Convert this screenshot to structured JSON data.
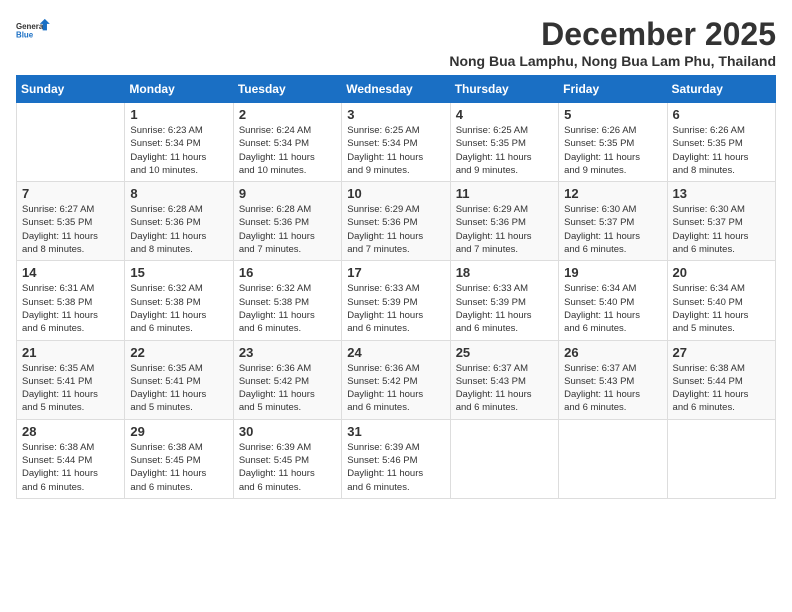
{
  "logo": {
    "line1": "General",
    "line2": "Blue"
  },
  "title": {
    "month": "December 2025",
    "location": "Nong Bua Lamphu, Nong Bua Lam Phu, Thailand"
  },
  "headers": [
    "Sunday",
    "Monday",
    "Tuesday",
    "Wednesday",
    "Thursday",
    "Friday",
    "Saturday"
  ],
  "weeks": [
    [
      {
        "day": "",
        "info": ""
      },
      {
        "day": "1",
        "info": "Sunrise: 6:23 AM\nSunset: 5:34 PM\nDaylight: 11 hours\nand 10 minutes."
      },
      {
        "day": "2",
        "info": "Sunrise: 6:24 AM\nSunset: 5:34 PM\nDaylight: 11 hours\nand 10 minutes."
      },
      {
        "day": "3",
        "info": "Sunrise: 6:25 AM\nSunset: 5:34 PM\nDaylight: 11 hours\nand 9 minutes."
      },
      {
        "day": "4",
        "info": "Sunrise: 6:25 AM\nSunset: 5:35 PM\nDaylight: 11 hours\nand 9 minutes."
      },
      {
        "day": "5",
        "info": "Sunrise: 6:26 AM\nSunset: 5:35 PM\nDaylight: 11 hours\nand 9 minutes."
      },
      {
        "day": "6",
        "info": "Sunrise: 6:26 AM\nSunset: 5:35 PM\nDaylight: 11 hours\nand 8 minutes."
      }
    ],
    [
      {
        "day": "7",
        "info": "Sunrise: 6:27 AM\nSunset: 5:35 PM\nDaylight: 11 hours\nand 8 minutes."
      },
      {
        "day": "8",
        "info": "Sunrise: 6:28 AM\nSunset: 5:36 PM\nDaylight: 11 hours\nand 8 minutes."
      },
      {
        "day": "9",
        "info": "Sunrise: 6:28 AM\nSunset: 5:36 PM\nDaylight: 11 hours\nand 7 minutes."
      },
      {
        "day": "10",
        "info": "Sunrise: 6:29 AM\nSunset: 5:36 PM\nDaylight: 11 hours\nand 7 minutes."
      },
      {
        "day": "11",
        "info": "Sunrise: 6:29 AM\nSunset: 5:36 PM\nDaylight: 11 hours\nand 7 minutes."
      },
      {
        "day": "12",
        "info": "Sunrise: 6:30 AM\nSunset: 5:37 PM\nDaylight: 11 hours\nand 6 minutes."
      },
      {
        "day": "13",
        "info": "Sunrise: 6:30 AM\nSunset: 5:37 PM\nDaylight: 11 hours\nand 6 minutes."
      }
    ],
    [
      {
        "day": "14",
        "info": "Sunrise: 6:31 AM\nSunset: 5:38 PM\nDaylight: 11 hours\nand 6 minutes."
      },
      {
        "day": "15",
        "info": "Sunrise: 6:32 AM\nSunset: 5:38 PM\nDaylight: 11 hours\nand 6 minutes."
      },
      {
        "day": "16",
        "info": "Sunrise: 6:32 AM\nSunset: 5:38 PM\nDaylight: 11 hours\nand 6 minutes."
      },
      {
        "day": "17",
        "info": "Sunrise: 6:33 AM\nSunset: 5:39 PM\nDaylight: 11 hours\nand 6 minutes."
      },
      {
        "day": "18",
        "info": "Sunrise: 6:33 AM\nSunset: 5:39 PM\nDaylight: 11 hours\nand 6 minutes."
      },
      {
        "day": "19",
        "info": "Sunrise: 6:34 AM\nSunset: 5:40 PM\nDaylight: 11 hours\nand 6 minutes."
      },
      {
        "day": "20",
        "info": "Sunrise: 6:34 AM\nSunset: 5:40 PM\nDaylight: 11 hours\nand 5 minutes."
      }
    ],
    [
      {
        "day": "21",
        "info": "Sunrise: 6:35 AM\nSunset: 5:41 PM\nDaylight: 11 hours\nand 5 minutes."
      },
      {
        "day": "22",
        "info": "Sunrise: 6:35 AM\nSunset: 5:41 PM\nDaylight: 11 hours\nand 5 minutes."
      },
      {
        "day": "23",
        "info": "Sunrise: 6:36 AM\nSunset: 5:42 PM\nDaylight: 11 hours\nand 5 minutes."
      },
      {
        "day": "24",
        "info": "Sunrise: 6:36 AM\nSunset: 5:42 PM\nDaylight: 11 hours\nand 6 minutes."
      },
      {
        "day": "25",
        "info": "Sunrise: 6:37 AM\nSunset: 5:43 PM\nDaylight: 11 hours\nand 6 minutes."
      },
      {
        "day": "26",
        "info": "Sunrise: 6:37 AM\nSunset: 5:43 PM\nDaylight: 11 hours\nand 6 minutes."
      },
      {
        "day": "27",
        "info": "Sunrise: 6:38 AM\nSunset: 5:44 PM\nDaylight: 11 hours\nand 6 minutes."
      }
    ],
    [
      {
        "day": "28",
        "info": "Sunrise: 6:38 AM\nSunset: 5:44 PM\nDaylight: 11 hours\nand 6 minutes."
      },
      {
        "day": "29",
        "info": "Sunrise: 6:38 AM\nSunset: 5:45 PM\nDaylight: 11 hours\nand 6 minutes."
      },
      {
        "day": "30",
        "info": "Sunrise: 6:39 AM\nSunset: 5:45 PM\nDaylight: 11 hours\nand 6 minutes."
      },
      {
        "day": "31",
        "info": "Sunrise: 6:39 AM\nSunset: 5:46 PM\nDaylight: 11 hours\nand 6 minutes."
      },
      {
        "day": "",
        "info": ""
      },
      {
        "day": "",
        "info": ""
      },
      {
        "day": "",
        "info": ""
      }
    ]
  ]
}
